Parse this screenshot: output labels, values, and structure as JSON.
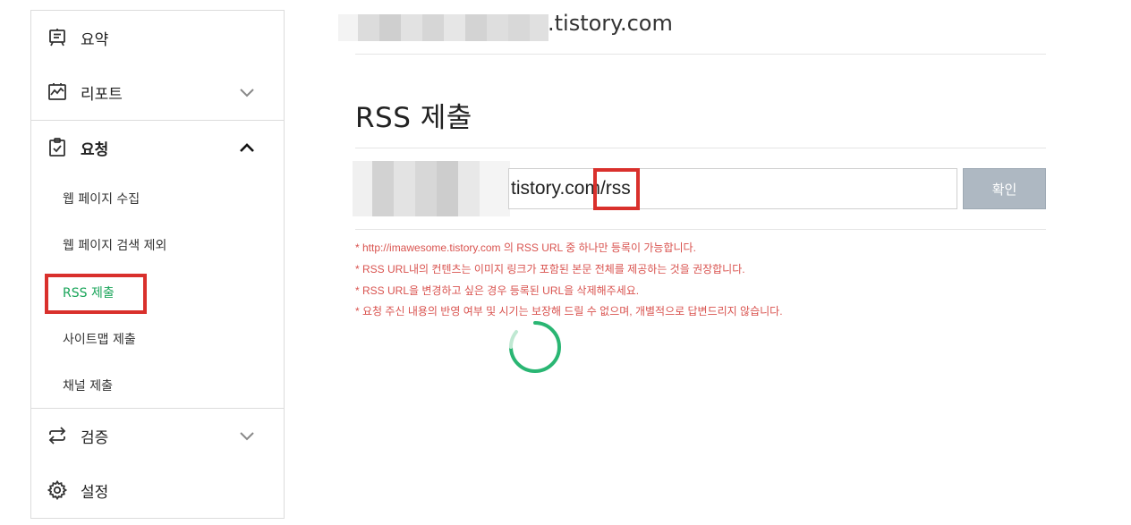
{
  "sidebar": {
    "items": [
      {
        "label": "요약",
        "icon": "summary-board-icon"
      },
      {
        "label": "리포트",
        "icon": "report-chart-icon"
      },
      {
        "label": "요청",
        "icon": "request-checklist-icon"
      },
      {
        "label": "검증",
        "icon": "verify-arrows-icon"
      },
      {
        "label": "설정",
        "icon": "settings-gear-icon"
      }
    ],
    "request_sub_items": [
      {
        "label": "웹 페이지 수집"
      },
      {
        "label": "웹 페이지 검색 제외"
      },
      {
        "label": "RSS 제출",
        "active": true
      },
      {
        "label": "사이트맵 제출"
      },
      {
        "label": "채널 제출"
      }
    ]
  },
  "main": {
    "site_domain": ".tistory.com",
    "title": "RSS 제출",
    "rss_input_value": "tistory.com/rss",
    "confirm_label": "확인",
    "notices": [
      "* http://imawesome.tistory.com 의 RSS URL 중 하나만 등록이 가능합니다.",
      "* RSS URL내의 컨텐츠는 이미지 링크가 포함된 본문 전체를 제공하는 것을 권장합니다.",
      "* RSS URL을 변경하고 싶은 경우 등록된 URL을 삭제해주세요.",
      "* 요청 주신 내용의 반영 여부 및 시기는 보장해 드릴 수 없으며, 개별적으로 답변드리지 않습니다."
    ]
  },
  "colors": {
    "active_green": "#1aa55a",
    "highlight_red": "#d9302c",
    "notice_red": "#d9534f",
    "button_gray": "#aeb8c2",
    "spinner_green": "#1fb26b"
  }
}
